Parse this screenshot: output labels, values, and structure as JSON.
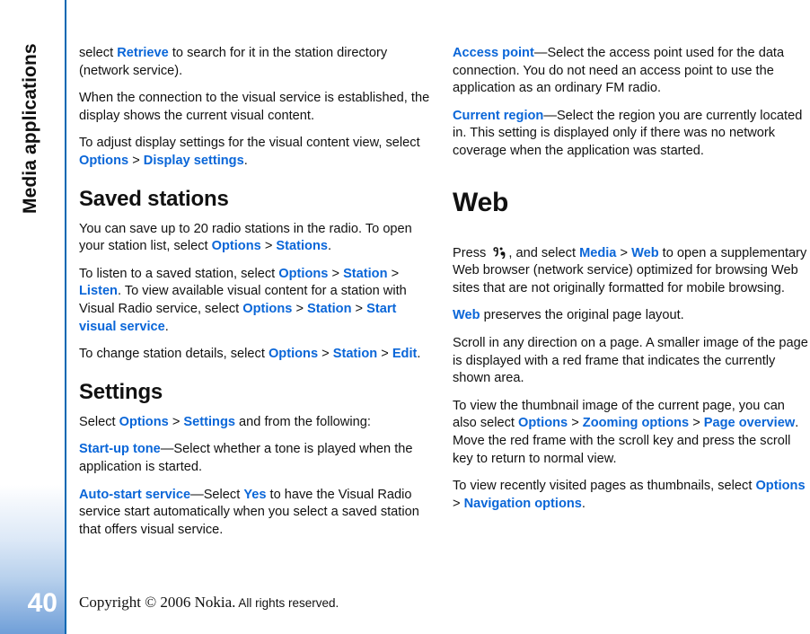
{
  "chapter": {
    "title": "Media applications",
    "page_number": "40"
  },
  "colors": {
    "link": "#0a66d8",
    "rule": "#0068b3",
    "sidebar_bottom": "#6f9fd8",
    "text": "#111111"
  },
  "left_column": {
    "p1": {
      "t1": "select ",
      "ui1": "Retrieve",
      "t2": " to search for it in the station directory (network service)."
    },
    "p2": {
      "t1": "When the connection to the visual service is established, the display shows the current visual content."
    },
    "p3": {
      "t1": "To adjust display settings for the visual content view, select ",
      "ui1": "Options",
      "gt1": " > ",
      "ui2": "Display settings",
      "t2": "."
    },
    "h_saved_stations": "Saved stations",
    "p4": {
      "t1": "You can save up to 20 radio stations in the radio. To open your station list, select ",
      "ui1": "Options",
      "gt1": " > ",
      "ui2": "Stations",
      "t2": "."
    },
    "p5": {
      "t1": "To listen to a saved station, select ",
      "ui1": "Options",
      "gt1": " > ",
      "ui2": "Station",
      "gt2": " > ",
      "ui3": "Listen",
      "t2": ". To view available visual content for a station with Visual Radio service, select ",
      "ui4": "Options",
      "gt3": " > ",
      "ui5": "Station",
      "gt4": " > ",
      "ui6": "Start visual service",
      "t3": "."
    },
    "p6": {
      "t1": "To change station details, select ",
      "ui1": "Options",
      "gt1": " > ",
      "ui2": "Station",
      "gt2": " > ",
      "ui3": "Edit",
      "t2": "."
    },
    "h_settings": "Settings",
    "p7": {
      "t1": "Select ",
      "ui1": "Options",
      "gt1": " > ",
      "ui2": "Settings",
      "t2": " and from the following:"
    },
    "p8": {
      "ui1": "Start-up tone",
      "t1": "—Select whether a tone is played when the application is started."
    },
    "p9": {
      "ui1": "Auto-start service",
      "t1": "—Select ",
      "ui2": "Yes",
      "t2": " to have the Visual Radio service start automatically when you select a saved station that offers visual service."
    }
  },
  "right_column": {
    "p1": {
      "ui1": "Access point",
      "t1": "—Select the access point used for the data connection. You do not need an access point to use the application as an ordinary FM radio."
    },
    "p2": {
      "ui1": "Current region",
      "t1": "—Select the region you are currently located in. This setting is displayed only if there was no network coverage when the application was started."
    },
    "h_web": "Web",
    "p3": {
      "t1": "Press ",
      "icon": "nokia-menu-key-icon",
      "t2": ", and select ",
      "ui1": "Media",
      "gt1": " > ",
      "ui2": "Web",
      "t3": " to open a supplementary Web browser (network service) optimized for browsing Web sites that are not originally formatted for mobile browsing."
    },
    "p4": {
      "ui1": "Web",
      "t1": " preserves the original page layout."
    },
    "p5": {
      "t1": "Scroll in any direction on a page. A smaller image of the page is displayed with a red frame that indicates the currently shown area."
    },
    "p6": {
      "t1": "To view the thumbnail image of the current page, you can also select ",
      "ui1": "Options",
      "gt1": " > ",
      "ui2": "Zooming options",
      "gt2": " > ",
      "ui3": "Page overview",
      "t2": ". Move the red frame with the scroll key and press the scroll key to return to normal view."
    },
    "p7": {
      "t1": "To view recently visited pages as thumbnails, select ",
      "ui1": "Options",
      "gt1": " > ",
      "ui2": "Navigation options",
      "t2": "."
    }
  },
  "footer": {
    "copyright": "Copyright © 2006 Nokia.",
    "rights": " All rights reserved."
  }
}
